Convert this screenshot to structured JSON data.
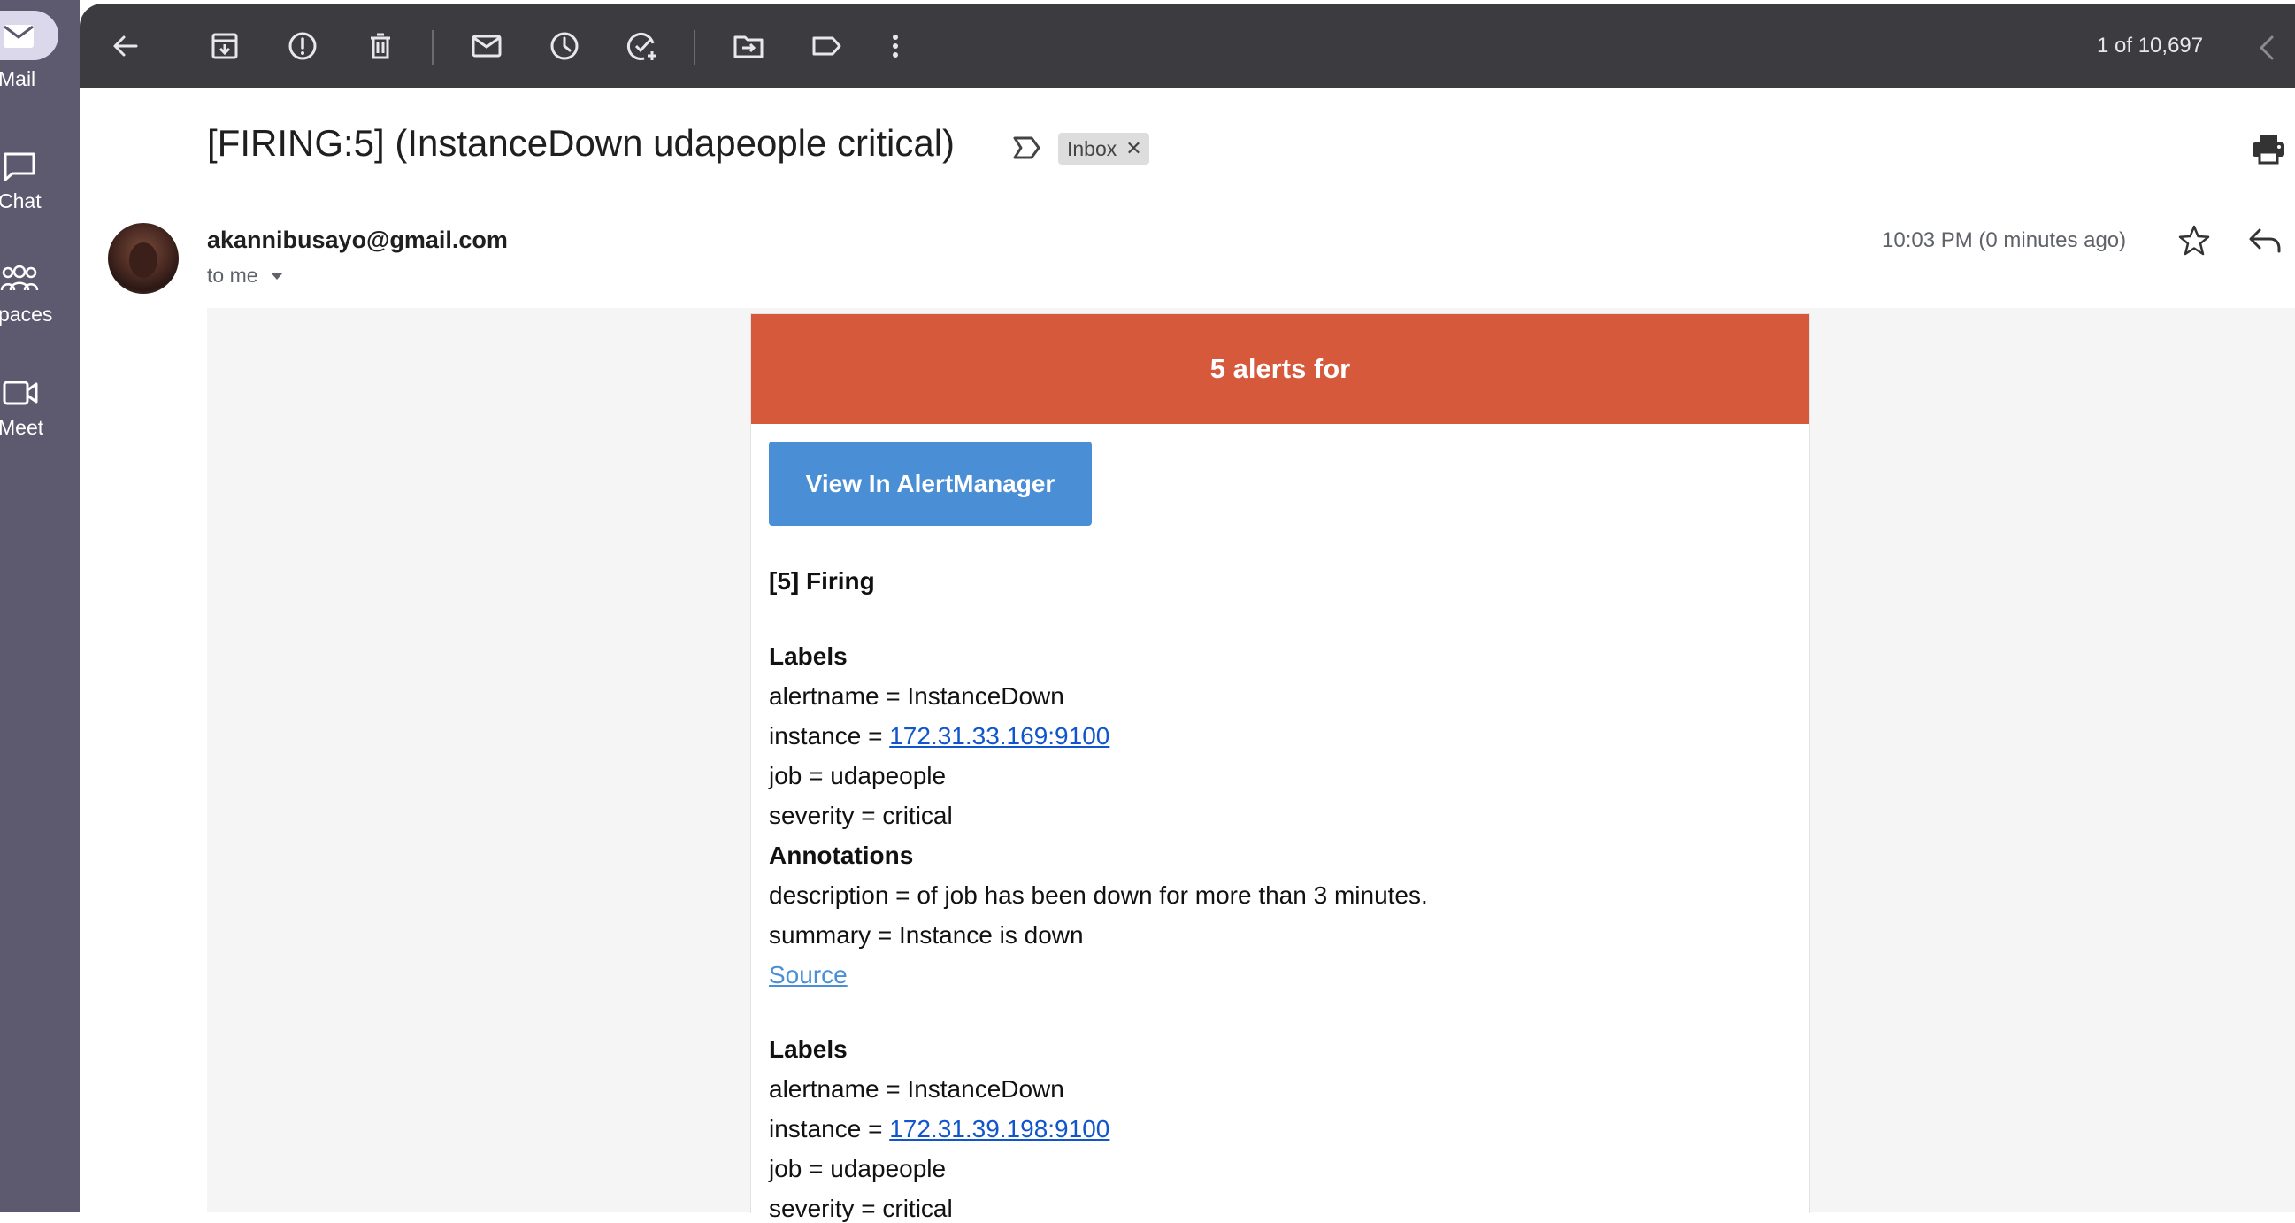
{
  "rail": {
    "items": [
      {
        "label": "Mail",
        "icon": "mail-icon"
      },
      {
        "label": "Chat",
        "icon": "chat-icon"
      },
      {
        "label": "paces",
        "icon": "spaces-icon"
      },
      {
        "label": "Meet",
        "icon": "meet-icon"
      }
    ]
  },
  "toolbar": {
    "icons": [
      "back-arrow-icon",
      "archive-icon",
      "report-spam-icon",
      "delete-icon",
      "mark-unread-icon",
      "snooze-icon",
      "add-to-tasks-icon",
      "move-to-icon",
      "label-icon",
      "more-icon"
    ],
    "count": "1 of 10,697"
  },
  "email": {
    "subject": "[FIRING:5] (InstanceDown udapeople critical)",
    "label_chip": "Inbox",
    "sender": "akannibusayo@gmail.com",
    "recipient": "to me",
    "timestamp": "10:03 PM (0 minutes ago)"
  },
  "message": {
    "header": "5 alerts for",
    "button": "View In AlertManager",
    "firing": "[5] Firing",
    "alerts": [
      {
        "labels_heading": "Labels",
        "alertname": "alertname = InstanceDown",
        "instance_prefix": "instance = ",
        "instance_link": "172.31.33.169:9100",
        "job": "job = udapeople",
        "severity": "severity = critical",
        "annotations_heading": "Annotations",
        "description": "description = of job has been down for more than 3 minutes.",
        "summary": "summary = Instance is down",
        "source": "Source"
      },
      {
        "labels_heading": "Labels",
        "alertname": "alertname = InstanceDown",
        "instance_prefix": "instance = ",
        "instance_link": "172.31.39.198:9100",
        "job": "job = udapeople",
        "severity": "severity = critical"
      }
    ]
  },
  "colors": {
    "rail": "#5d5a70",
    "toolbar": "#3c3c40",
    "alert_header": "#d5593a",
    "button": "#4a8fd6",
    "link": "#1155cc"
  }
}
